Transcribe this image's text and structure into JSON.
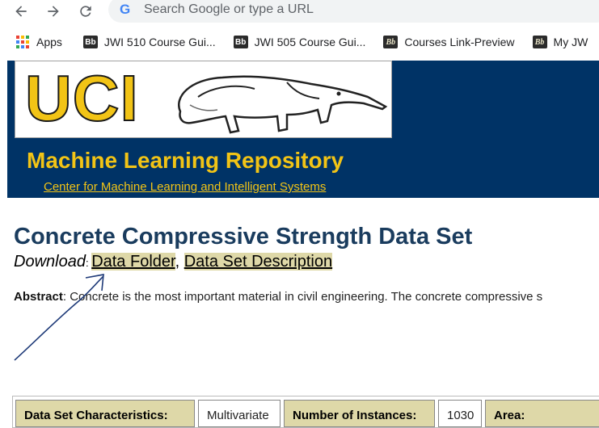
{
  "browser": {
    "omnibox_placeholder": "Search Google or type a URL",
    "bookmarks": [
      {
        "label": "Apps"
      },
      {
        "label": "JWI 510 Course Gui...",
        "icon_text": "Bb"
      },
      {
        "label": "JWI 505 Course Gui...",
        "icon_text": "Bb"
      },
      {
        "label": "Courses Link-Preview",
        "icon_text": "Bb"
      },
      {
        "label": "My JW",
        "icon_text": "Bb"
      }
    ]
  },
  "header": {
    "logo_text": "UCI",
    "repo_title": "Machine Learning Repository",
    "center_link": "Center for Machine Learning and Intelligent Systems"
  },
  "dataset": {
    "title": "Concrete Compressive Strength Data Set",
    "download_label": "Download",
    "download_sep": ": ",
    "data_folder": "Data Folder",
    "link_sep": ", ",
    "data_set_description": "Data Set Description",
    "abstract_label": "Abstract",
    "abstract_text": ": Concrete is the most important material in civil engineering. The concrete compressive s"
  },
  "characteristics": {
    "c1_label": "Data Set Characteristics:",
    "c1_value": "Multivariate",
    "c2_label": "Number of Instances:",
    "c2_value": "1030",
    "c3_label": "Area:"
  },
  "colors": {
    "banner": "#003366",
    "uci_gold": "#f2c416",
    "title_blue": "#1a3c5e",
    "link_highlight": "#ded8a8"
  }
}
